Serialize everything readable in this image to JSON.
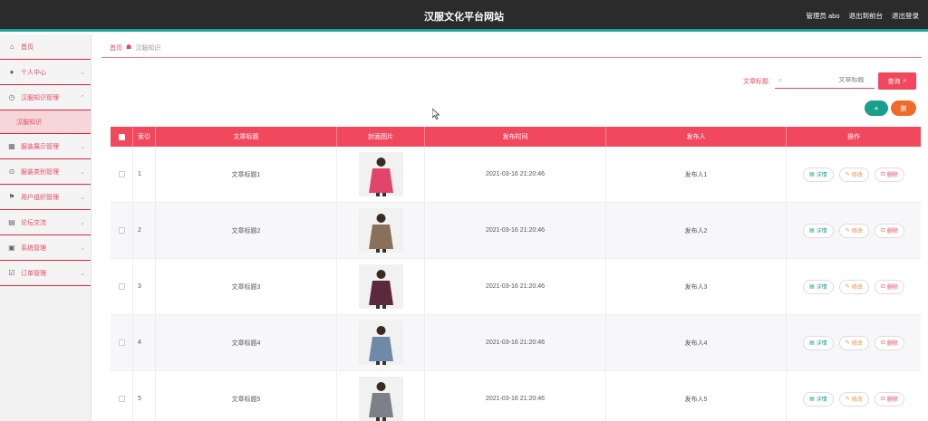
{
  "app": {
    "title": "汉服文化平台网站",
    "user_label": "管理员 abo",
    "backend_link": "退出到前台",
    "logout_link": "退出登录"
  },
  "sidebar": {
    "items": [
      {
        "label": "首页",
        "icon": "home-icon"
      },
      {
        "label": "个人中心",
        "icon": "user-icon"
      },
      {
        "label": "汉服知识管理",
        "icon": "clock-icon"
      },
      {
        "label": "汉服知识",
        "icon": ""
      },
      {
        "label": "服装展示管理",
        "icon": "grid-icon"
      },
      {
        "label": "服装类别管理",
        "icon": "circle-icon"
      },
      {
        "label": "用户组织管理",
        "icon": "flag-icon"
      },
      {
        "label": "论坛交流",
        "icon": "table-icon"
      },
      {
        "label": "系统管理",
        "icon": "box-icon"
      },
      {
        "label": "订单管理",
        "icon": "check-icon"
      }
    ]
  },
  "breadcrumb": {
    "home": "首页",
    "current": "汉服知识"
  },
  "search": {
    "label": "文章标题",
    "placeholder": "文章标题",
    "button": "查询"
  },
  "actions": {
    "add": "+",
    "delete": "删"
  },
  "table": {
    "headers": [
      "",
      "索引",
      "文章标题",
      "封面图片",
      "发布时间",
      "发布人",
      "操作"
    ],
    "rows": [
      {
        "index": "1",
        "title": "文章标题1",
        "time": "2021-03-16 21:20:46",
        "publisher": "发布人1",
        "img_color": "#e2456a"
      },
      {
        "index": "2",
        "title": "文章标题2",
        "time": "2021-03-16 21:20:46",
        "publisher": "发布人2",
        "img_color": "#8a6f5a"
      },
      {
        "index": "3",
        "title": "文章标题3",
        "time": "2021-03-16 21:20:46",
        "publisher": "发布人3",
        "img_color": "#5a2a3c"
      },
      {
        "index": "4",
        "title": "文章标题4",
        "time": "2021-03-16 21:20:46",
        "publisher": "发布人4",
        "img_color": "#6f8aa8"
      },
      {
        "index": "5",
        "title": "文章标题5",
        "time": "2021-03-16 21:20:46",
        "publisher": "发布人5",
        "img_color": "#7d8089"
      }
    ],
    "ops": {
      "detail": "详情",
      "edit": "修改",
      "delete": "删除"
    }
  },
  "colors": {
    "accent": "#f2485e",
    "topbar": "#2b2b2b",
    "teal": "#18a08c",
    "orange": "#f26a2a"
  }
}
